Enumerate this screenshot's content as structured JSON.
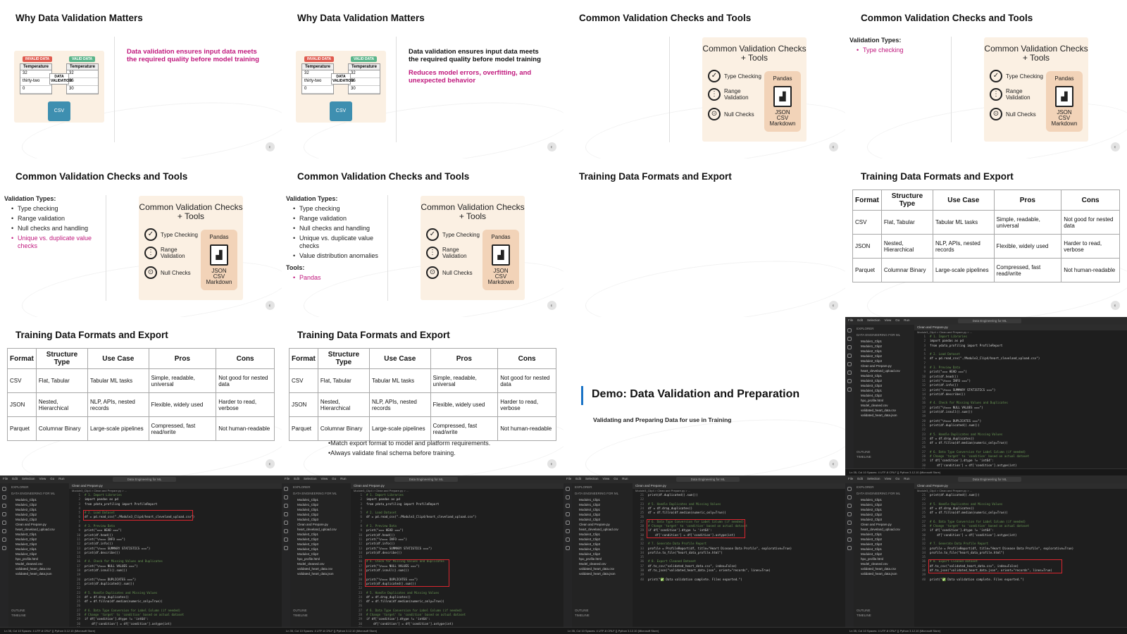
{
  "s_why": {
    "title": "Why Data Validation Matters",
    "para1": "Data validation ensures input data meets the required quality before model training",
    "para2": "Reduces model errors, overfitting, and unexpected behavior",
    "illus": {
      "invalid": "INVALID DATA",
      "valid": "VALID DATA",
      "col": "Temperature",
      "box": "DATA VALIDATION",
      "left": [
        "32",
        "thirty-two",
        "0"
      ],
      "right": [
        "32",
        "26",
        "30"
      ],
      "cloud": "CSV"
    }
  },
  "s_checks": {
    "title": "Common Validation Checks and Tools",
    "card_title": "Common Validation Checks + Tools",
    "checks": [
      "Type Checking",
      "Range Validation",
      "Null Checks"
    ],
    "pandas": "Pandas",
    "formats": [
      "JSON",
      "CSV",
      "Markdown"
    ],
    "types_header": "Validation Types:",
    "types": [
      "Type checking",
      "Range validation",
      "Null checks and handling",
      "Unique vs. duplicate value checks",
      "Value distribution anomalies"
    ],
    "tools_header": "Tools:",
    "tools": [
      "Pandas"
    ]
  },
  "s_formats": {
    "title": "Training Data Formats and Export",
    "headers": [
      "Format",
      "Structure Type",
      "Use Case",
      "Pros",
      "Cons"
    ],
    "rows": [
      [
        "CSV",
        "Flat, Tabular",
        "Tabular ML tasks",
        "Simple, readable, universal",
        "Not good for nested data"
      ],
      [
        "JSON",
        "Nested, Hierarchical",
        "NLP, APIs, nested records",
        "Flexible, widely used",
        "Harder to read, verbose"
      ],
      [
        "Parquet",
        "Columnar Binary",
        "Large-scale pipelines",
        "Compressed, fast read/write",
        "Not human-readable"
      ]
    ],
    "notes": [
      "•Match export format to model and platform requirements.",
      "•Always validate final schema before training."
    ]
  },
  "s_demo": {
    "title": "Demo: Data Validation and Preparation",
    "subtitle": "Validating and Preparing Data for use in Training"
  },
  "vs": {
    "menu": [
      "File",
      "Edit",
      "Selection",
      "View",
      "Go",
      "Run"
    ],
    "window_title": "Data Engineering for ML",
    "explorer": "EXPLORER",
    "root": "DATA ENGINEERING FOR ML",
    "files": [
      "Module1_Clip1",
      "Module1_Clip2",
      "Module2_Clip1",
      "Module2_Clip2",
      "Module2_Clip3",
      "Clean and Prepare.py",
      "heart_cleveland_upload.csv",
      "Module3_Clip1",
      "Module3_Clip2",
      "Module3_Clip3",
      "Module4_Clip1",
      "Module4_Clip2",
      "hpo_profile.html",
      "Model_cleaned.csv",
      "validated_heart_data.csv",
      "validated_heart_data.json"
    ],
    "outline": "OUTLINE",
    "timeline": "TIMELINE",
    "tab": "Clean and Prepare.py",
    "crumb": "Module3_Clip4 > Clean and Prepare.py > ...",
    "status": "Ln 35, Col 10   Spaces: 4   UTF-8   CRLF   {} Python   3.12.10 (Microsoft Store)",
    "code_top": [
      "# 1. Import Libraries",
      "import pandas as pd",
      "from ydata_profiling import ProfileReport",
      "",
      "# 2. Load Dataset",
      "df = pd.read_csv(\"./Module3_Clip4/heart_cleveland_upload.csv\")",
      "",
      "# 3. Preview Data",
      "print(\"=== HEAD ===\")",
      "print(df.head())",
      "print(\"\\n=== INFO ===\")",
      "print(df.info())",
      "print(\"\\n=== SUMMARY STATISTICS ===\")",
      "print(df.describe())",
      "",
      "# 4. Check for Missing Values and Duplicates",
      "print(\"\\n=== NULL VALUES ===\")",
      "print(df.isnull().sum())",
      "",
      "print(\"\\n=== DUPLICATES ===\")",
      "print(df.duplicated().sum())",
      "",
      "# 5. Handle Duplicates and Missing Values",
      "df = df.drop_duplicates()",
      "df = df.fillna(df.median(numeric_only=True))",
      "",
      "# 6. Data Type Conversion for Label Column (if needed)",
      "# Change 'target' to 'condition' based on actual dataset",
      "if df['condition'].dtype != 'int64':",
      "    df['condition'] = df['condition'].astype(int)",
      "",
      "# 7. Generate Data Profile Report",
      "profile = ProfileReport(df, title=\"Heart Disease Data Profile\", explorative=True)"
    ],
    "code_bottom": [
      "print(df.duplicated().sum())",
      "",
      "# 5. Handle Duplicates and Missing Values",
      "df = df.drop_duplicates()",
      "df = df.fillna(df.median(numeric_only=True))",
      "",
      "# 6. Data Type Conversion for Label Column (if needed)",
      "# Change 'target' to 'condition' based on actual dataset",
      "if df['condition'].dtype != 'int64':",
      "    df['condition'] = df['condition'].astype(int)",
      "",
      "# 7. Generate Data Profile Report",
      "profile = ProfileReport(df, title=\"Heart Disease Data Profile\", explorative=True)",
      "profile.to_file(\"heart_data_profile.html\")",
      "",
      "# 8. Export Cleaned Dataset",
      "df.to_csv(\"validated_heart_data.csv\", index=False)",
      "df.to_json(\"validated_heart_data.json\", orient=\"records\", lines=True)",
      "",
      "print(\"✅ Data validation complete. Files exported.\")"
    ]
  }
}
